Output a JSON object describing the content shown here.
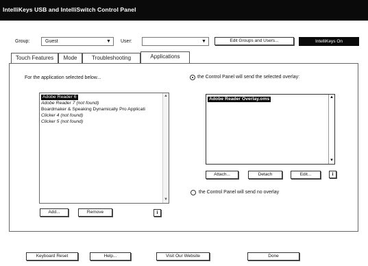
{
  "window": {
    "title": "IntelliKeys USB and IntelliSwitch Control Panel"
  },
  "header": {
    "group_label": "Group:",
    "group_value": "Guest",
    "user_label": "User:",
    "user_value": "",
    "edit_groups_button": "Edit Groups and Users...",
    "status_button": "IntelliKeys On"
  },
  "tabs": [
    {
      "label": "Touch Features"
    },
    {
      "label": "Mode"
    },
    {
      "label": "Troubleshooting"
    },
    {
      "label": "Applications",
      "active": true
    }
  ],
  "applications": {
    "prompt": "For the application selected below...",
    "list": [
      {
        "text": "Adobe Reader 6",
        "selected": true,
        "italic": false
      },
      {
        "text": "Adobe Reader 7 (not found)",
        "selected": false,
        "italic": true
      },
      {
        "text": "Boardmaker & Speaking Dynamically Pro Applicati",
        "selected": false,
        "italic": false
      },
      {
        "text": "Clicker 4 (not found)",
        "selected": false,
        "italic": true
      },
      {
        "text": "Clicker 5 (not found)",
        "selected": false,
        "italic": true
      }
    ],
    "add_button": "Add...",
    "remove_button": "Remove",
    "info_label": "i"
  },
  "overlay": {
    "send_selected_label": "the Control Panel will send the selected overlay:",
    "send_none_label": "the Control Panel will send no overlay",
    "selected_option": "send_selected",
    "list": [
      {
        "text": "Adobe Reader Overlay.oms",
        "selected": true
      }
    ],
    "attach_button": "Attach...",
    "detach_button": "Detach",
    "edit_button": "Edit...",
    "info_label": "i"
  },
  "footer": {
    "keyboard_reset": "Keyboard Reset",
    "help": "Help...",
    "visit_website": "Visit Our Website",
    "done": "Done"
  }
}
